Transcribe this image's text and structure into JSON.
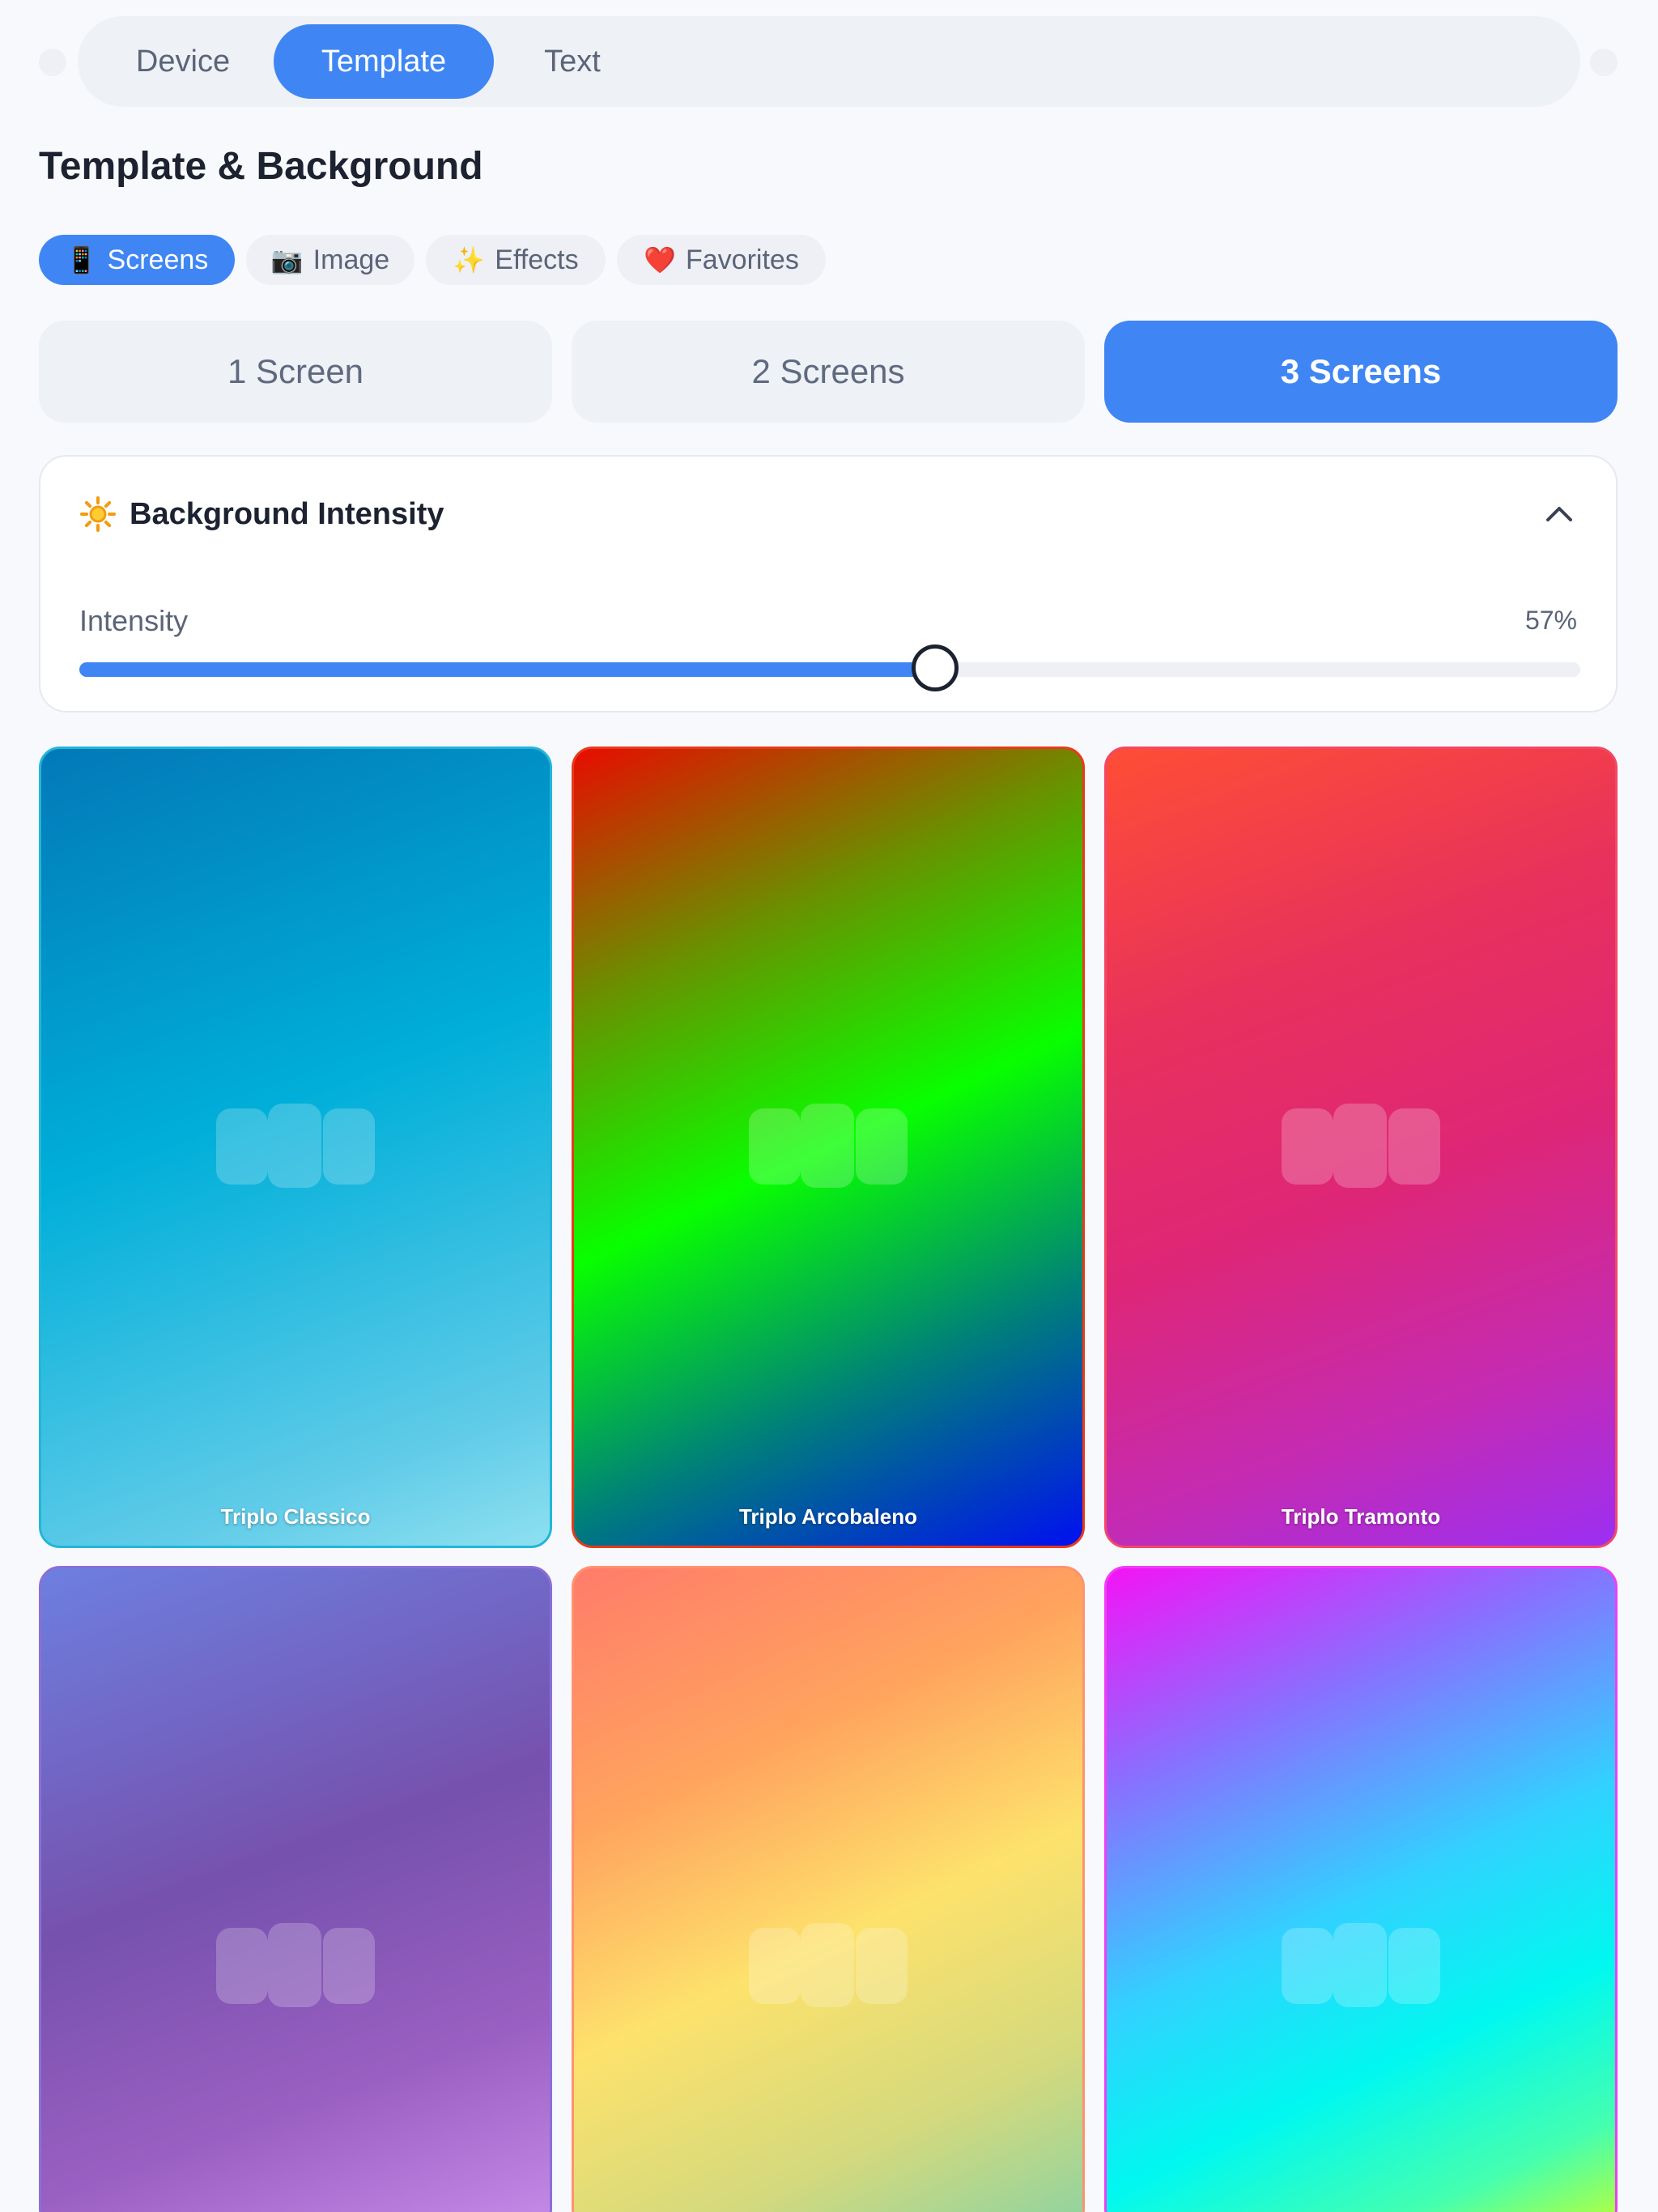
{
  "top_tabs": {
    "device": "Device",
    "template": "Template",
    "text": "Text",
    "active": "Template"
  },
  "section": {
    "title": "Template & Background"
  },
  "categories": [
    {
      "icon": "mobile-phone-icon",
      "emoji": "📱",
      "label": "Screens",
      "active": true
    },
    {
      "icon": "camera-icon",
      "emoji": "📷",
      "label": "Image",
      "active": false
    },
    {
      "icon": "sparkles-icon",
      "emoji": "✨",
      "label": "Effects",
      "active": false
    },
    {
      "icon": "heart-icon",
      "emoji": "❤️",
      "label": "Favorites",
      "active": false
    }
  ],
  "screen_counts": [
    {
      "label": "1 Screen",
      "active": false
    },
    {
      "label": "2 Screens",
      "active": false
    },
    {
      "label": "3 Screens",
      "active": true
    }
  ],
  "intensity": {
    "title": "Background Intensity",
    "label": "Intensity",
    "value_text": "57%",
    "value": 0.57,
    "collapse_icon": "chevron-up-icon",
    "header_icon": "sun-icon"
  },
  "templates": [
    {
      "name": "Triplo Classico",
      "colors": [
        "#0279b8",
        "#00afd9",
        "#8ee0f0"
      ]
    },
    {
      "name": "Triplo Arcobaleno",
      "colors": [
        "#e80c00",
        "#08ff00",
        "#0010f0"
      ]
    },
    {
      "name": "Triplo Tramonto",
      "colors": [
        "#fe4e35",
        "#de2677",
        "#9c2ff2"
      ]
    },
    {
      "name": "",
      "colors": [
        "#6d7fe0",
        "#7651ad",
        "#c68ae8"
      ]
    },
    {
      "name": "",
      "colors": [
        "#ff7c6a",
        "#fde26c",
        "#8ed3a0"
      ]
    },
    {
      "name": "",
      "colors": [
        "#f413f6",
        "#00f8f0",
        "#b8ff3a"
      ]
    }
  ],
  "colors": {
    "accent": "#3f86f4",
    "text_primary": "#1c2230",
    "text_secondary": "#5b6478"
  }
}
